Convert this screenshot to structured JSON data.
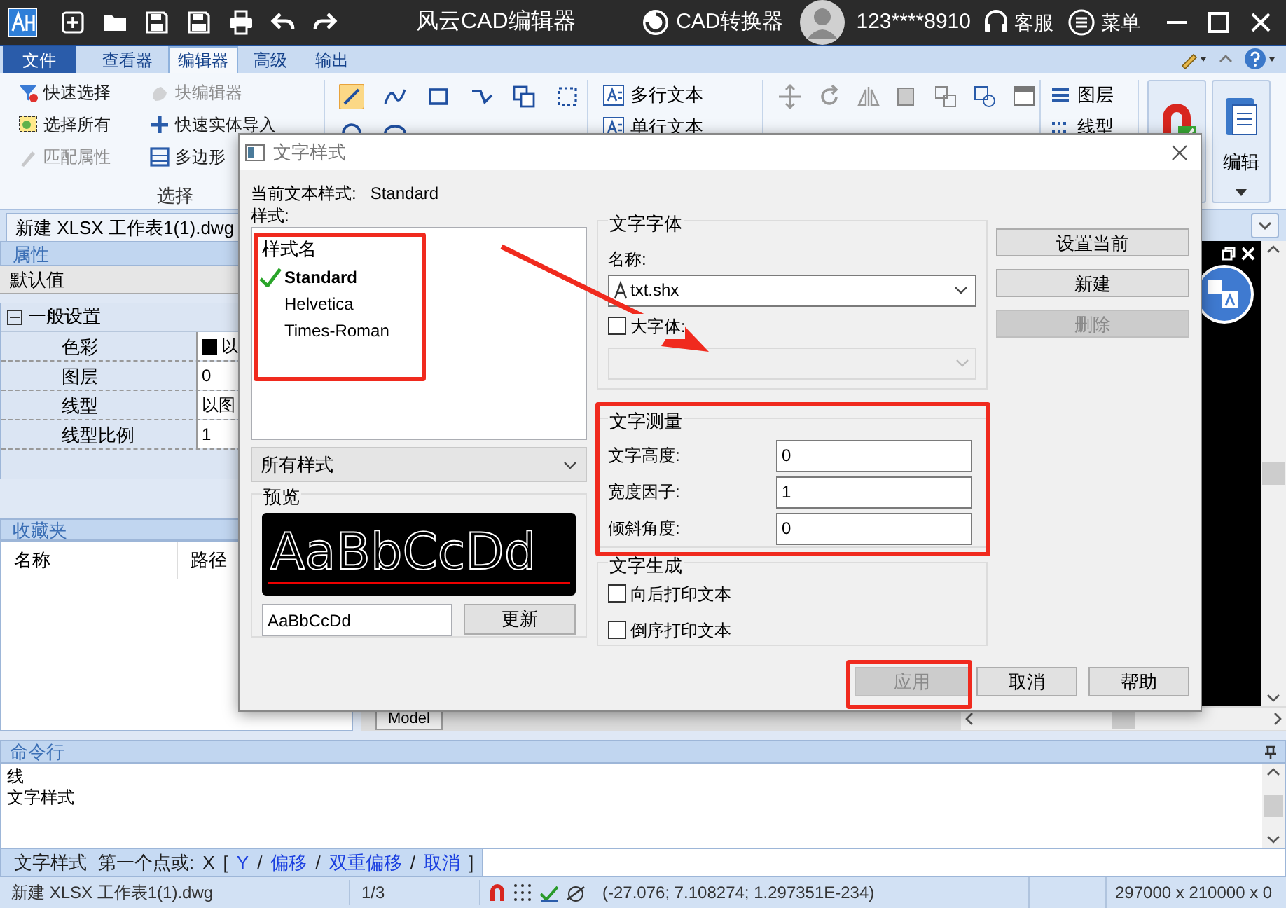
{
  "title_bar": {
    "title": "风云CAD编辑器",
    "converter": "CAD转换器",
    "user": "123****8910",
    "support": "客服",
    "menu": "菜单"
  },
  "ribbon_tabs": [
    {
      "label": "文件",
      "kind": "file",
      "selected": false
    },
    {
      "label": "查看器",
      "kind": "tab",
      "selected": false
    },
    {
      "label": "编辑器",
      "kind": "tab",
      "selected": true
    },
    {
      "label": "高级",
      "kind": "tab",
      "selected": false
    },
    {
      "label": "输出",
      "kind": "tab",
      "selected": false
    }
  ],
  "ribbon": {
    "select_group": {
      "label": "选择",
      "items": [
        {
          "label": "快速选择",
          "disabled": false
        },
        {
          "label": "块编辑器",
          "disabled": true
        },
        {
          "label": "选择所有",
          "disabled": false
        },
        {
          "label": "快速实体导入",
          "disabled": false
        },
        {
          "label": "匹配属性",
          "disabled": true
        },
        {
          "label": "多边形",
          "disabled": false
        }
      ]
    },
    "text_items": [
      "多行文本",
      "单行文本"
    ],
    "layer_items": [
      "图层",
      "线型"
    ],
    "edit_button": "编辑"
  },
  "document_tab": "新建 XLSX 工作表1(1).dwg",
  "properties": {
    "title": "属性",
    "default": "默认值",
    "group": {
      "label": "一般设置",
      "expanded": true
    },
    "rows": [
      {
        "name": "色彩",
        "value": "以",
        "kind": "color"
      },
      {
        "name": "图层",
        "value": "0",
        "kind": "text"
      },
      {
        "name": "线型",
        "value": "以图",
        "kind": "text"
      },
      {
        "name": "线型比例",
        "value": "1",
        "kind": "text"
      }
    ]
  },
  "favorites": {
    "title": "收藏夹",
    "columns": [
      "名称",
      "路径"
    ]
  },
  "model_tab": "Model",
  "command_line": {
    "title": "命令行",
    "history": [
      "线",
      "文字样式"
    ],
    "prompt": [
      {
        "text": "文字样式",
        "kind": "plain"
      },
      {
        "text": "第一个点或:",
        "kind": "plain"
      },
      {
        "text": "X",
        "kind": "plain"
      },
      {
        "text": "[",
        "kind": "plain"
      },
      {
        "text": "Y",
        "kind": "option"
      },
      {
        "text": "/",
        "kind": "plain"
      },
      {
        "text": "偏移",
        "kind": "option"
      },
      {
        "text": "/",
        "kind": "plain"
      },
      {
        "text": "双重偏移",
        "kind": "option"
      },
      {
        "text": "/",
        "kind": "plain"
      },
      {
        "text": "取消",
        "kind": "option"
      },
      {
        "text": "]",
        "kind": "plain"
      }
    ]
  },
  "status_bar": {
    "file": "新建 XLSX 工作表1(1).dwg",
    "page": "1/3",
    "coordinates": "(-27.076; 7.108274; 1.297351E-234)",
    "size": "297000 x 210000 x 0"
  },
  "dialog": {
    "title": "文字样式",
    "current_label": "当前文本样式:",
    "current_value": "Standard",
    "styles_label": "样式:",
    "styles_header": "样式名",
    "styles": [
      {
        "name": "Standard",
        "selected": true
      },
      {
        "name": "Helvetica",
        "selected": false
      },
      {
        "name": "Times-Roman",
        "selected": false
      }
    ],
    "filter": "所有样式",
    "preview": {
      "label": "预览",
      "rendered": "AaBbCcDd",
      "sample": "AaBbCcDd",
      "update_button": "更新"
    },
    "font": {
      "label": "文字字体",
      "name_label": "名称:",
      "name_value": "txt.shx",
      "bigfont_label": "大字体:",
      "bigfont_checked": false
    },
    "metrics": {
      "label": "文字测量",
      "fields": [
        {
          "label": "文字高度:",
          "value": "0"
        },
        {
          "label": "宽度因子:",
          "value": "1"
        },
        {
          "label": "倾斜角度:",
          "value": "0"
        }
      ]
    },
    "generation": {
      "label": "文字生成",
      "options": [
        {
          "label": "向后打印文本",
          "checked": false
        },
        {
          "label": "倒序打印文本",
          "checked": false
        }
      ]
    },
    "side_buttons": [
      {
        "label": "设置当前",
        "disabled": false
      },
      {
        "label": "新建",
        "disabled": false
      },
      {
        "label": "删除",
        "disabled": true
      }
    ],
    "bottom_buttons": [
      {
        "label": "应用",
        "disabled": true
      },
      {
        "label": "取消",
        "disabled": false
      },
      {
        "label": "帮助",
        "disabled": false
      }
    ]
  }
}
